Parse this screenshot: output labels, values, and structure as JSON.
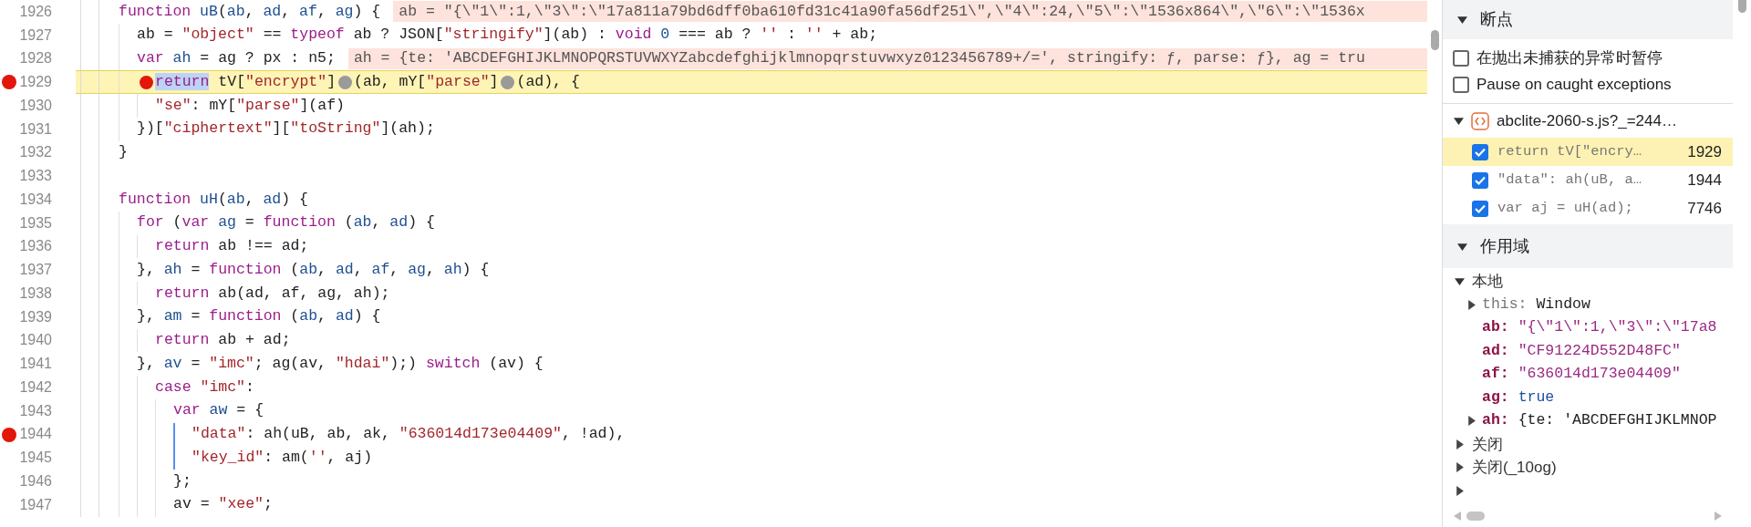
{
  "editor": {
    "lines": [
      {
        "number": "1926",
        "breakpoint": false,
        "paused": false,
        "tokens": [
          {
            "kind": "kw",
            "text": "function"
          },
          {
            "kind": "def",
            "text": " uB"
          },
          {
            "kind": "plain",
            "text": "("
          },
          {
            "kind": "def",
            "text": "ab"
          },
          {
            "kind": "plain",
            "text": ", "
          },
          {
            "kind": "def",
            "text": "ad"
          },
          {
            "kind": "plain",
            "text": ", "
          },
          {
            "kind": "def",
            "text": "af"
          },
          {
            "kind": "plain",
            "text": ", "
          },
          {
            "kind": "def",
            "text": "ag"
          },
          {
            "kind": "plain",
            "text": ") {"
          }
        ],
        "inline_value": "ab = \"{\\\"1\\\":1,\\\"3\\\":\\\"17a811a79bd6dff0ba610fd31c41a90fa56df251\\\",\\\"4\\\":24,\\\"5\\\":\\\"1536x864\\\",\\\"6\\\":\\\"1536x"
      },
      {
        "number": "1927",
        "breakpoint": false,
        "paused": false,
        "tokens": [
          {
            "kind": "plain",
            "text": "  ab = "
          },
          {
            "kind": "str",
            "text": "\"object\""
          },
          {
            "kind": "plain",
            "text": " == "
          },
          {
            "kind": "kw",
            "text": "typeof"
          },
          {
            "kind": "plain",
            "text": " ab ? JSON["
          },
          {
            "kind": "str",
            "text": "\"stringify\""
          },
          {
            "kind": "plain",
            "text": "](ab) : "
          },
          {
            "kind": "kw",
            "text": "void"
          },
          {
            "kind": "num",
            "text": " 0"
          },
          {
            "kind": "plain",
            "text": " === ab ? "
          },
          {
            "kind": "str",
            "text": "''"
          },
          {
            "kind": "plain",
            "text": " : "
          },
          {
            "kind": "str",
            "text": "''"
          },
          {
            "kind": "plain",
            "text": " + ab;"
          }
        ]
      },
      {
        "number": "1928",
        "breakpoint": false,
        "paused": false,
        "tokens": [
          {
            "kind": "kw",
            "text": "  var"
          },
          {
            "kind": "def",
            "text": " ah"
          },
          {
            "kind": "plain",
            "text": " = ag ? px : n5;"
          }
        ],
        "inline_value": "ah = {te: 'ABCDEFGHIJKLMNOPQRSTUVWXYZabcdefghijklmnopqrstuvwxyz0123456789+/=', stringify: ƒ, parse: ƒ}, ag = tru"
      },
      {
        "number": "1929",
        "breakpoint": true,
        "paused": true,
        "tokens": [
          {
            "kind": "marker",
            "on": true
          },
          {
            "kind": "selected",
            "text": "  return"
          },
          {
            "kind": "plain",
            "text": " tV["
          },
          {
            "kind": "str",
            "text": "\"encrypt\""
          },
          {
            "kind": "plain",
            "text": "]"
          },
          {
            "kind": "marker",
            "on": false
          },
          {
            "kind": "plain",
            "text": "(ab, mY["
          },
          {
            "kind": "str",
            "text": "\"parse\""
          },
          {
            "kind": "plain",
            "text": "]"
          },
          {
            "kind": "marker",
            "on": false
          },
          {
            "kind": "plain",
            "text": "(ad), {"
          }
        ]
      },
      {
        "number": "1930",
        "breakpoint": false,
        "paused": false,
        "tokens": [
          {
            "kind": "str",
            "text": "    \"se\""
          },
          {
            "kind": "plain",
            "text": ": mY["
          },
          {
            "kind": "str",
            "text": "\"parse\""
          },
          {
            "kind": "plain",
            "text": "](af)"
          }
        ]
      },
      {
        "number": "1931",
        "breakpoint": false,
        "paused": false,
        "tokens": [
          {
            "kind": "plain",
            "text": "  })["
          },
          {
            "kind": "str",
            "text": "\"ciphertext\""
          },
          {
            "kind": "plain",
            "text": "]["
          },
          {
            "kind": "str",
            "text": "\"toString\""
          },
          {
            "kind": "plain",
            "text": "](ah);"
          }
        ]
      },
      {
        "number": "1932",
        "breakpoint": false,
        "paused": false,
        "tokens": [
          {
            "kind": "plain",
            "text": "}"
          }
        ]
      },
      {
        "number": "1933",
        "breakpoint": false,
        "paused": false
      },
      {
        "number": "1934",
        "breakpoint": false,
        "paused": false,
        "tokens": [
          {
            "kind": "kw",
            "text": "function"
          },
          {
            "kind": "def",
            "text": " uH"
          },
          {
            "kind": "plain",
            "text": "("
          },
          {
            "kind": "def",
            "text": "ab"
          },
          {
            "kind": "plain",
            "text": ", "
          },
          {
            "kind": "def",
            "text": "ad"
          },
          {
            "kind": "plain",
            "text": ") {"
          }
        ]
      },
      {
        "number": "1935",
        "breakpoint": false,
        "paused": false,
        "tokens": [
          {
            "kind": "kw",
            "text": "  for"
          },
          {
            "kind": "plain",
            "text": " ("
          },
          {
            "kind": "kw",
            "text": "var"
          },
          {
            "kind": "def",
            "text": " ag"
          },
          {
            "kind": "plain",
            "text": " = "
          },
          {
            "kind": "kw",
            "text": "function"
          },
          {
            "kind": "plain",
            "text": " ("
          },
          {
            "kind": "def",
            "text": "ab"
          },
          {
            "kind": "plain",
            "text": ", "
          },
          {
            "kind": "def",
            "text": "ad"
          },
          {
            "kind": "plain",
            "text": ") {"
          }
        ]
      },
      {
        "number": "1936",
        "breakpoint": false,
        "paused": false,
        "tokens": [
          {
            "kind": "kw",
            "text": "    return"
          },
          {
            "kind": "plain",
            "text": " ab !== ad;"
          }
        ]
      },
      {
        "number": "1937",
        "breakpoint": false,
        "paused": false,
        "tokens": [
          {
            "kind": "plain",
            "text": "  }, "
          },
          {
            "kind": "def",
            "text": "ah"
          },
          {
            "kind": "plain",
            "text": " = "
          },
          {
            "kind": "kw",
            "text": "function"
          },
          {
            "kind": "plain",
            "text": " ("
          },
          {
            "kind": "def",
            "text": "ab"
          },
          {
            "kind": "plain",
            "text": ", "
          },
          {
            "kind": "def",
            "text": "ad"
          },
          {
            "kind": "plain",
            "text": ", "
          },
          {
            "kind": "def",
            "text": "af"
          },
          {
            "kind": "plain",
            "text": ", "
          },
          {
            "kind": "def",
            "text": "ag"
          },
          {
            "kind": "plain",
            "text": ", "
          },
          {
            "kind": "def",
            "text": "ah"
          },
          {
            "kind": "plain",
            "text": ") {"
          }
        ]
      },
      {
        "number": "1938",
        "breakpoint": false,
        "paused": false,
        "tokens": [
          {
            "kind": "kw",
            "text": "    return"
          },
          {
            "kind": "plain",
            "text": " ab(ad, af, ag, ah);"
          }
        ]
      },
      {
        "number": "1939",
        "breakpoint": false,
        "paused": false,
        "tokens": [
          {
            "kind": "plain",
            "text": "  }, "
          },
          {
            "kind": "def",
            "text": "am"
          },
          {
            "kind": "plain",
            "text": " = "
          },
          {
            "kind": "kw",
            "text": "function"
          },
          {
            "kind": "plain",
            "text": " ("
          },
          {
            "kind": "def",
            "text": "ab"
          },
          {
            "kind": "plain",
            "text": ", "
          },
          {
            "kind": "def",
            "text": "ad"
          },
          {
            "kind": "plain",
            "text": ") {"
          }
        ]
      },
      {
        "number": "1940",
        "breakpoint": false,
        "paused": false,
        "tokens": [
          {
            "kind": "kw",
            "text": "    return"
          },
          {
            "kind": "plain",
            "text": " ab + ad;"
          }
        ]
      },
      {
        "number": "1941",
        "breakpoint": false,
        "paused": false,
        "tokens": [
          {
            "kind": "plain",
            "text": "  }, "
          },
          {
            "kind": "def",
            "text": "av"
          },
          {
            "kind": "plain",
            "text": " = "
          },
          {
            "kind": "str",
            "text": "\"imc\""
          },
          {
            "kind": "plain",
            "text": "; ag(av, "
          },
          {
            "kind": "str",
            "text": "\"hdai\""
          },
          {
            "kind": "plain",
            "text": ");) "
          },
          {
            "kind": "kw",
            "text": "switch"
          },
          {
            "kind": "plain",
            "text": " (av) {"
          }
        ]
      },
      {
        "number": "1942",
        "breakpoint": false,
        "paused": false,
        "tokens": [
          {
            "kind": "kw",
            "text": "    case"
          },
          {
            "kind": "str",
            "text": " \"imc\""
          },
          {
            "kind": "plain",
            "text": ":"
          }
        ]
      },
      {
        "number": "1943",
        "breakpoint": false,
        "paused": false,
        "tokens": [
          {
            "kind": "kw",
            "text": "      var"
          },
          {
            "kind": "def",
            "text": " aw"
          },
          {
            "kind": "plain",
            "text": " = {"
          }
        ]
      },
      {
        "number": "1944",
        "breakpoint": true,
        "paused": false,
        "active_scope": true,
        "tokens": [
          {
            "kind": "str",
            "text": "        \"data\""
          },
          {
            "kind": "plain",
            "text": ": ah(uB, ab, ak, "
          },
          {
            "kind": "str",
            "text": "\"636014d173e04409\""
          },
          {
            "kind": "plain",
            "text": ", !ad),"
          }
        ]
      },
      {
        "number": "1945",
        "breakpoint": false,
        "paused": false,
        "active_scope": true,
        "tokens": [
          {
            "kind": "str",
            "text": "        \"key_id\""
          },
          {
            "kind": "plain",
            "text": ": am("
          },
          {
            "kind": "str",
            "text": "''"
          },
          {
            "kind": "plain",
            "text": ", aj)"
          }
        ]
      },
      {
        "number": "1946",
        "breakpoint": false,
        "paused": false,
        "tokens": [
          {
            "kind": "plain",
            "text": "      };"
          }
        ]
      },
      {
        "number": "1947",
        "breakpoint": false,
        "paused": false,
        "tokens": [
          {
            "kind": "plain",
            "text": "      av = "
          },
          {
            "kind": "str",
            "text": "\"xee\""
          },
          {
            "kind": "plain",
            "text": ";"
          }
        ]
      }
    ]
  },
  "breakpoints": {
    "title": "断点",
    "expanded": true,
    "options": [
      {
        "label": "在抛出未捕获的异常时暂停",
        "checked": false
      },
      {
        "label": "Pause on caught exceptions",
        "checked": false
      }
    ],
    "files": [
      {
        "name": "abclite-2060-s.js?_=244…",
        "expanded": true,
        "items": [
          {
            "code": "return tV[\"encry…",
            "line": "1929",
            "checked": true,
            "selected": true
          },
          {
            "code": "\"data\": ah(uB, a…",
            "line": "1944",
            "checked": true,
            "selected": false
          },
          {
            "code": "var aj = uH(ad);",
            "line": "7746",
            "checked": true,
            "selected": false
          }
        ]
      }
    ]
  },
  "scope": {
    "title": "作用域",
    "expanded": true,
    "groups": [
      {
        "label": "本地",
        "expanded": true,
        "children": [
          {
            "kind": "this",
            "name": "this:",
            "value": "Window"
          },
          {
            "kind": "string",
            "name": "ab:",
            "value": "\"{\\\"1\\\":1,\\\"3\\\":\\\"17a8"
          },
          {
            "kind": "string",
            "name": "ad:",
            "value": "\"CF91224D552D48FC\""
          },
          {
            "kind": "string",
            "name": "af:",
            "value": "\"636014d173e04409\""
          },
          {
            "kind": "boolean",
            "name": "ag:",
            "value": "true"
          },
          {
            "kind": "object",
            "name": "ah:",
            "value": "{te: 'ABCDEFGHIJKLMNOP"
          }
        ]
      },
      {
        "label": "关闭",
        "expanded": false
      },
      {
        "label": "关闭(_10og)",
        "expanded": false
      },
      {
        "expanded": false
      }
    ]
  }
}
